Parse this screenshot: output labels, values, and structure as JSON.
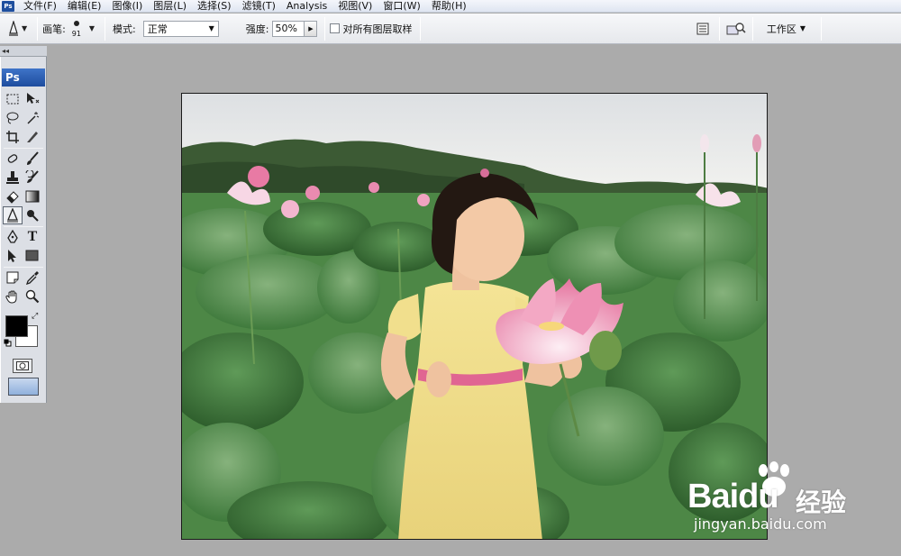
{
  "menubar": {
    "items": [
      {
        "label": "文件(F)"
      },
      {
        "label": "编辑(E)"
      },
      {
        "label": "图像(I)"
      },
      {
        "label": "图层(L)"
      },
      {
        "label": "选择(S)"
      },
      {
        "label": "滤镜(T)"
      },
      {
        "label": "Analysis"
      },
      {
        "label": "视图(V)"
      },
      {
        "label": "窗口(W)"
      },
      {
        "label": "帮助(H)"
      }
    ]
  },
  "options": {
    "brush_label": "画笔:",
    "brush_size": "91",
    "mode_label": "模式:",
    "mode_value": "正常",
    "strength_label": "强度:",
    "strength_value": "50%",
    "sample_all_label": "对所有图层取样",
    "sample_all_checked": false,
    "workspace_label": "工作区"
  },
  "toolbox": {
    "header": "Ps",
    "active_tool": "smudge-tool",
    "foreground_color": "#000000",
    "background_color": "#ffffff"
  },
  "watermark": {
    "logo_text": "Baidu",
    "logo_cn": "经验",
    "url": "jingyan.baidu.com"
  }
}
